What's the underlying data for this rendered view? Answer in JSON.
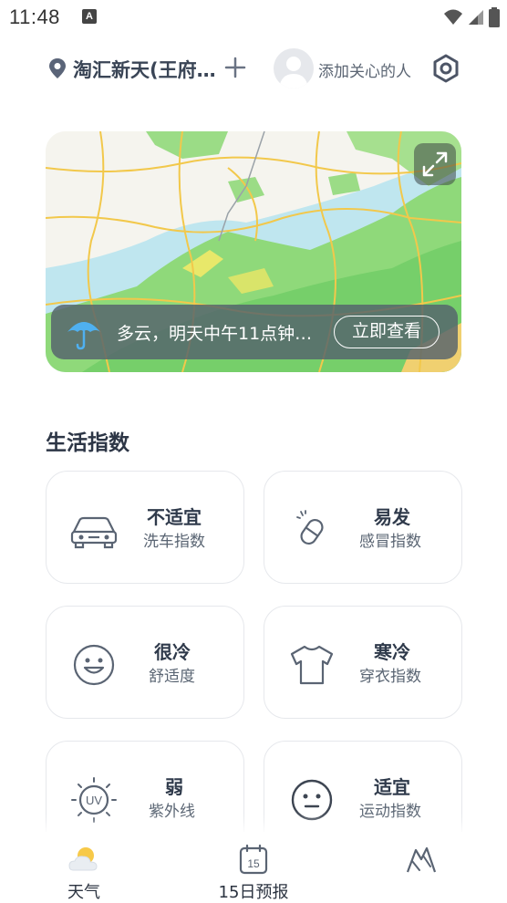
{
  "status_bar": {
    "time": "11:48",
    "notification_glyph": "A"
  },
  "header": {
    "location": "淘汇新天(王府…",
    "care_label": "添加关心的人"
  },
  "radar": {
    "alert_text": "多云，明天中午11点钟…",
    "view_button": "立即查看"
  },
  "life_index": {
    "title": "生活指数",
    "cards": [
      {
        "value": "不适宜",
        "name": "洗车指数",
        "icon": "car-icon"
      },
      {
        "value": "易发",
        "name": "感冒指数",
        "icon": "pill-icon"
      },
      {
        "value": "很冷",
        "name": "舒适度",
        "icon": "smiley-icon"
      },
      {
        "value": "寒冷",
        "name": "穿衣指数",
        "icon": "tshirt-icon"
      },
      {
        "value": "弱",
        "name": "紫外线",
        "icon": "uv-icon"
      },
      {
        "value": "适宜",
        "name": "运动指数",
        "icon": "neutral-face-icon"
      }
    ]
  },
  "bottom_nav": {
    "items": [
      {
        "label": "天气",
        "icon": "cloudy-weather-icon",
        "active": true
      },
      {
        "label": "15日预报",
        "icon": "calendar-15-icon",
        "calendar_day": "15"
      },
      {
        "label": "",
        "icon": "mountain-icon"
      }
    ]
  },
  "colors": {
    "accent_text": "#2f3a4b",
    "alert_bar": "#54626c",
    "map_rain_green": "#7fd36a",
    "map_road": "#f2c84b"
  }
}
